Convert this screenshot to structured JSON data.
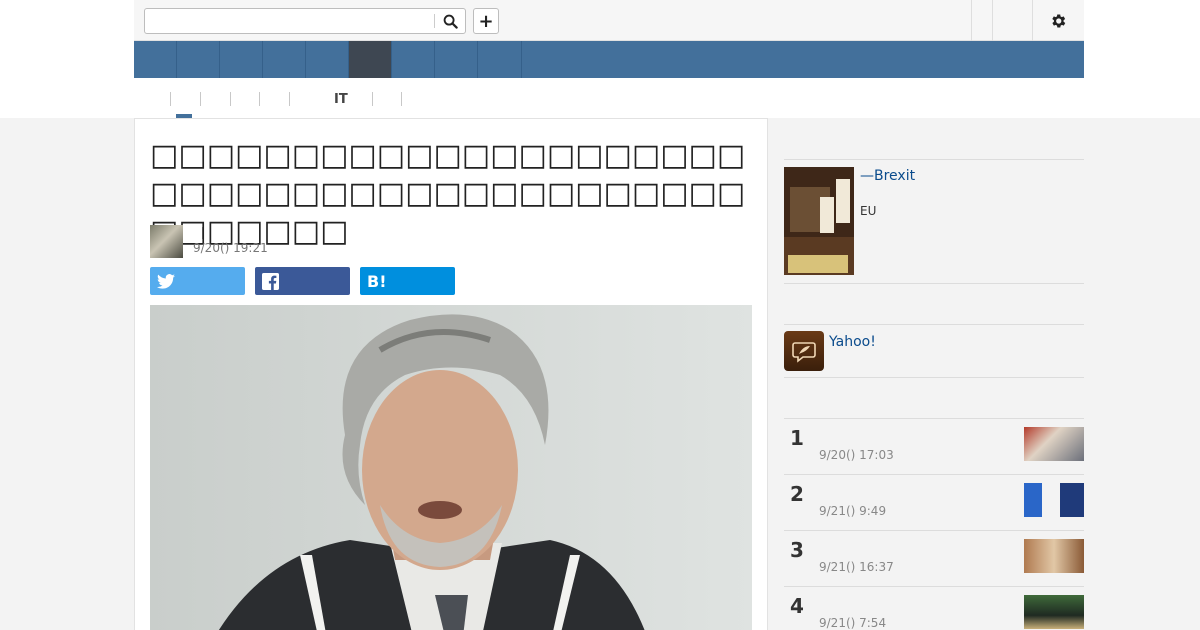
{
  "header": {
    "search_placeholder": "",
    "search_icon": "search-icon",
    "add_label": "+",
    "settings_icon": "gear-icon"
  },
  "nav": {
    "active_index": 5
  },
  "subnav": {
    "items": [
      "",
      "",
      "",
      "",
      "",
      "IT",
      "",
      ""
    ]
  },
  "article": {
    "title": "□□□□□□□□□□□□□□□□□□□□□□□□□□□□□□□□□□□□□□□□□□□□□□□□□",
    "author_name": "",
    "date": "9/20() 19:21",
    "share_twitter_icon": "twitter-icon",
    "share_facebook_icon": "facebook-icon",
    "share_hatena_label": "B!"
  },
  "sidebar": {
    "book": {
      "title": "—Brexit",
      "subtitle": "EU"
    },
    "yahoo_link": "Yahoo!",
    "ranking": [
      {
        "rank": "1",
        "date": "9/20() 17:03"
      },
      {
        "rank": "2",
        "date": "9/21() 9:49"
      },
      {
        "rank": "3",
        "date": "9/21() 16:37"
      },
      {
        "rank": "4",
        "date": "9/21() 7:54"
      }
    ]
  },
  "colors": {
    "nav_bg": "#43709b",
    "nav_active": "#3e4752",
    "twitter": "#55acee",
    "facebook": "#3b5998",
    "hatena": "#008fde",
    "link": "#0a4b8c"
  }
}
